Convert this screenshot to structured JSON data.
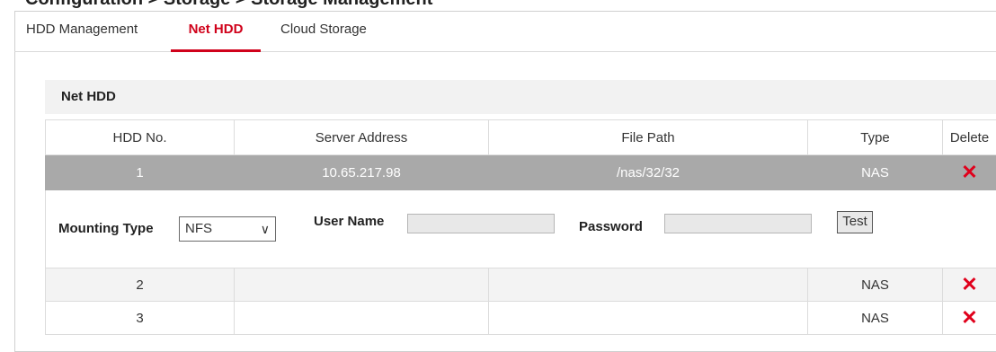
{
  "page": {
    "heading": "Configuration > Storage > Storage Management"
  },
  "tabs": [
    {
      "label": "HDD Management"
    },
    {
      "label": "Net HDD"
    },
    {
      "label": "Cloud Storage"
    }
  ],
  "section": {
    "title": "Net HDD"
  },
  "table": {
    "columns": [
      "HDD No.",
      "Server Address",
      "File Path",
      "Type",
      "Delete"
    ],
    "rows": [
      {
        "no": "1",
        "address": "10.65.217.98",
        "path": "/nas/32/32",
        "type": "NAS"
      },
      {
        "no": "2",
        "address": "",
        "path": "",
        "type": "NAS"
      },
      {
        "no": "3",
        "address": "",
        "path": "",
        "type": "NAS"
      }
    ]
  },
  "detail": {
    "mounting_label": "Mounting Type",
    "mounting_value": "NFS",
    "user_label": "User Name",
    "user_value": "",
    "password_label": "Password",
    "password_value": "",
    "test_label": "Test"
  },
  "icons": {
    "delete": "close-x-icon",
    "dropdown": "chevron-down-icon"
  },
  "colors": {
    "accent": "#d0021b",
    "selected_row": "#a9a9a9",
    "delete_icon": "#e0001b"
  }
}
